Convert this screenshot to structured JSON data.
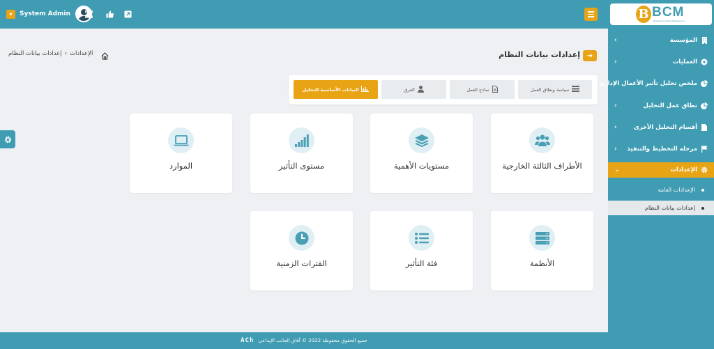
{
  "header": {
    "user_name": "System Admin",
    "icons": [
      "chevron-down-icon",
      "user-avatar",
      "fullscreen-icon",
      "thumbs-up-icon",
      "external-link-icon",
      "hamburger-icon"
    ]
  },
  "sidebar": {
    "logo_text": "BCM",
    "logo_letter": "B",
    "logo_sub": "Business Continuity Management",
    "items": [
      {
        "label": "المؤسسة",
        "icon": "building-icon"
      },
      {
        "label": "العمليات",
        "icon": "process-icon"
      },
      {
        "label": "ملخص تحليل تأثير الأعمال الإداري",
        "icon": "pie-chart-icon"
      },
      {
        "label": "نطاق عمل التحليل",
        "icon": "pie-chart-icon"
      },
      {
        "label": "أقسام التحليل الأخرى",
        "icon": "file-icon"
      },
      {
        "label": "مرحله التخطيط والتنفيذ",
        "icon": "flag-icon"
      },
      {
        "label": "الإعدادات",
        "icon": "gear-icon"
      }
    ],
    "sub_items": [
      {
        "label": "الإعدادات العامة"
      },
      {
        "label": "إعدادات بيانات النظام"
      }
    ]
  },
  "breadcrumb": {
    "items": [
      "الإعدادات",
      "إعدادات بيانات النظام"
    ],
    "separator": "›"
  },
  "page": {
    "title": "إعدادات بيانات النظام"
  },
  "tabs": [
    {
      "label": "سياسة ونطاق العمل",
      "icon": "list-icon"
    },
    {
      "label": "نماذج العمل",
      "icon": "document-icon"
    },
    {
      "label": "الفرق",
      "icon": "user-icon"
    },
    {
      "label": "البيانات الأساسية للتحليل",
      "icon": "bar-chart-icon"
    }
  ],
  "cards": [
    {
      "label": "الأطراف الثالثة الخارجية",
      "icon": "users-group-icon"
    },
    {
      "label": "مستويات الأهمية",
      "icon": "layers-icon"
    },
    {
      "label": "مستوى التأثير",
      "icon": "signal-bars-icon"
    },
    {
      "label": "الموارد",
      "icon": "laptop-icon"
    },
    {
      "label": "الأنظمة",
      "icon": "server-icon"
    },
    {
      "label": "فئة التأثير",
      "icon": "list-icon"
    },
    {
      "label": "الفترات الزمنية",
      "icon": "clock-icon"
    }
  ],
  "footer": {
    "text": "جميع الحقوق محفوظة 2022 © أفاق الجانب الإبداعي",
    "logo": "ACh"
  },
  "colors": {
    "primary": "#3f9cb3",
    "accent": "#e9a415",
    "icon_bg": "#dfeff4",
    "page_bg": "#eef0f3"
  }
}
